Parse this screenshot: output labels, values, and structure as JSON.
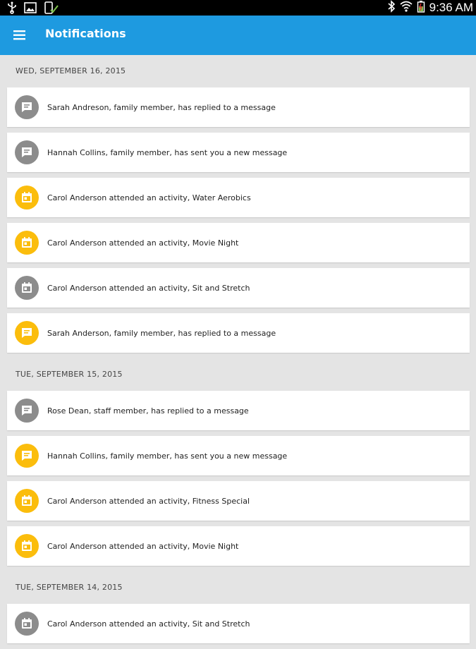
{
  "status": {
    "time": "9:36 AM"
  },
  "header": {
    "title": "Notifications"
  },
  "colors": {
    "app_bar": "#1e9ae0",
    "unread": "#fbbd0c",
    "read": "#8c8c8c",
    "background": "#e4e4e4"
  },
  "groups": [
    {
      "date": "WED, SEPTEMBER 16, 2015",
      "items": [
        {
          "text": "Sarah Andreson, family member, has replied to a message",
          "icon": "message-icon",
          "color": "gray"
        },
        {
          "text": "Hannah Collins, family member, has sent you a new message",
          "icon": "message-icon",
          "color": "gray"
        },
        {
          "text": "Carol Anderson attended an activity, Water Aerobics",
          "icon": "calendar-icon",
          "color": "yellow"
        },
        {
          "text": "Carol Anderson attended an activity, Movie Night",
          "icon": "calendar-icon",
          "color": "yellow"
        },
        {
          "text": "Carol Anderson attended an activity, Sit and Stretch",
          "icon": "calendar-icon",
          "color": "gray"
        },
        {
          "text": "Sarah Anderson, family member, has replied to a message",
          "icon": "message-icon",
          "color": "yellow"
        }
      ]
    },
    {
      "date": "TUE, SEPTEMBER 15, 2015",
      "items": [
        {
          "text": "Rose Dean, staff member, has replied to a message",
          "icon": "message-icon",
          "color": "gray"
        },
        {
          "text": "Hannah Collins, family member, has sent you a new message",
          "icon": "message-icon",
          "color": "yellow"
        },
        {
          "text": "Carol Anderson attended an activity, Fitness Special",
          "icon": "calendar-icon",
          "color": "yellow"
        },
        {
          "text": "Carol Anderson attended an activity, Movie Night",
          "icon": "calendar-icon",
          "color": "yellow"
        }
      ]
    },
    {
      "date": "TUE, SEPTEMBER 14, 2015",
      "items": [
        {
          "text": "Carol Anderson attended an activity, Sit and Stretch",
          "icon": "calendar-icon",
          "color": "gray"
        }
      ]
    }
  ]
}
